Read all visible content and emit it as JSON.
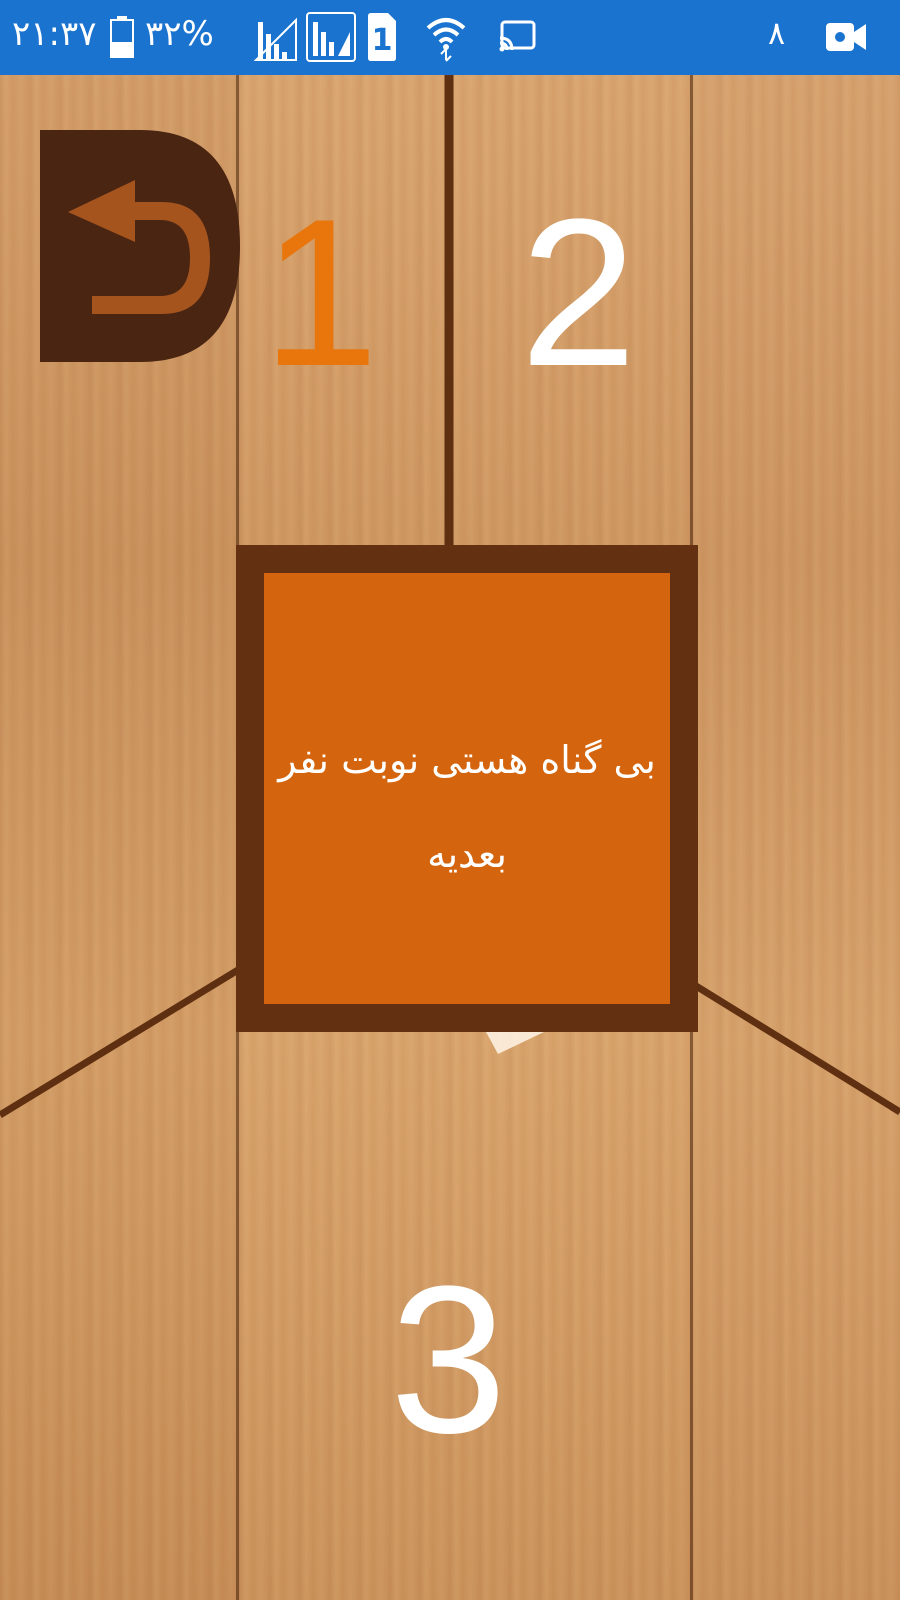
{
  "status_bar": {
    "time": "۲۱:۳۷",
    "battery": "۳۲%",
    "right_number": "۸",
    "colors": {
      "background": "#1a73cf",
      "foreground": "#ffffff"
    },
    "icons": [
      "battery-icon",
      "signal-icon",
      "signal-sim-icon",
      "sim-1-icon",
      "wifi-icon",
      "cast-icon",
      "video-camera-icon"
    ]
  },
  "game": {
    "back_icon": "back-arrow-icon",
    "players": {
      "p1": "1",
      "p2": "2",
      "p3": "3"
    },
    "active_player_color": "#e8760d",
    "message": "بی گناه هستی نوبت نفر بعدیه",
    "colors": {
      "card_fill": "#d4650e",
      "card_border": "#633112",
      "divider": "#5e2f10"
    }
  }
}
